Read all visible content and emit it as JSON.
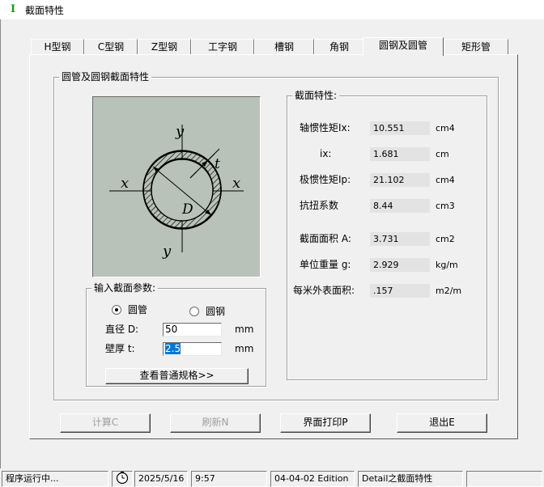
{
  "window": {
    "title": "截面特性",
    "icon": "app-icon"
  },
  "tabs": [
    {
      "label": "H型钢"
    },
    {
      "label": "C型钢"
    },
    {
      "label": "Z型钢"
    },
    {
      "label": "工字钢"
    },
    {
      "label": "槽钢"
    },
    {
      "label": "角钢"
    },
    {
      "label": "圆钢及圆管",
      "active": true
    },
    {
      "label": "矩形管"
    }
  ],
  "group_main": {
    "title": "圆管及圆钢截面特性"
  },
  "diagram": {
    "label_y_top": "y",
    "label_y_bottom": "y",
    "label_x_left": "x",
    "label_x_right": "x",
    "label_t": "t",
    "label_D": "D"
  },
  "input_group": {
    "title": "输入截面参数:",
    "radio_tube": "圆管",
    "radio_bar": "圆钢",
    "selected": "圆管",
    "diameter_label": "直径 D:",
    "diameter_value": "50",
    "diameter_unit": "mm",
    "thickness_label": "壁厚 t:",
    "thickness_value": "2.5",
    "thickness_unit": "mm",
    "spec_button": "查看普通规格>>"
  },
  "properties": {
    "title": "截面特性:",
    "rows": [
      {
        "label": "轴惯性矩Ix:",
        "value": "10.551",
        "unit": "cm4"
      },
      {
        "label": "ix:",
        "value": "1.681",
        "unit": "cm"
      },
      {
        "label": "极惯性矩Ip:",
        "value": "21.102",
        "unit": "cm4"
      },
      {
        "label": "抗扭系数",
        "value": "8.44",
        "unit": "cm3"
      },
      {
        "label": "截面面积 A:",
        "value": "3.731",
        "unit": "cm2"
      },
      {
        "label": "单位重量 g:",
        "value": "2.929",
        "unit": "kg/m"
      },
      {
        "label": "每米外表面积:",
        "value": ".157",
        "unit": "m2/m"
      }
    ]
  },
  "buttons": {
    "calc": "计算C",
    "refresh": "刷新N",
    "print": "界面打印P",
    "exit": "退出E"
  },
  "statusbar": {
    "status": "程序运行中...",
    "date": "2025/5/16",
    "time": "9:57",
    "edition": "04-04-02 Edition",
    "detail": "Detail之截面特性"
  },
  "colors": {
    "diagram_bg": "#b8c2b8",
    "selection": "#0078d7",
    "app_icon": "#1a9a1a"
  }
}
